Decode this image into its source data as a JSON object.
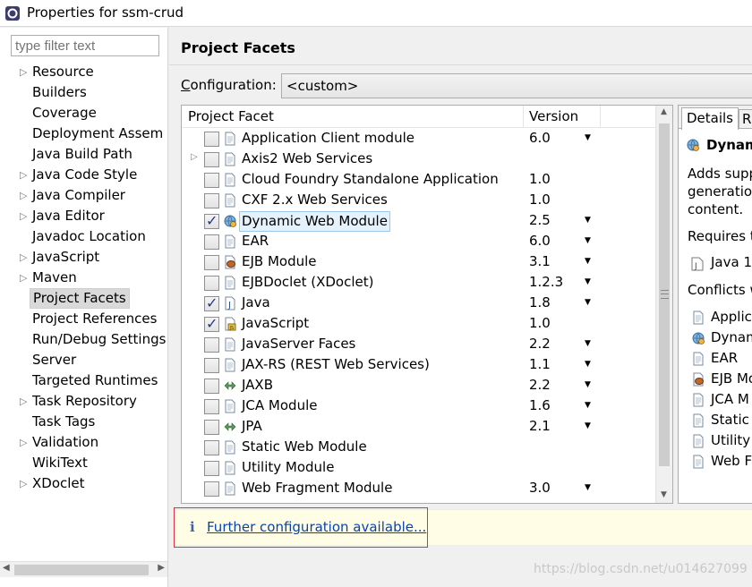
{
  "window": {
    "title": "Properties for ssm-crud"
  },
  "filter": {
    "placeholder": "type filter text"
  },
  "sidebar": {
    "items": [
      {
        "label": "Resource",
        "expandable": true
      },
      {
        "label": "Builders",
        "expandable": false
      },
      {
        "label": "Coverage",
        "expandable": false
      },
      {
        "label": "Deployment Assem",
        "expandable": false
      },
      {
        "label": "Java Build Path",
        "expandable": false
      },
      {
        "label": "Java Code Style",
        "expandable": true
      },
      {
        "label": "Java Compiler",
        "expandable": true
      },
      {
        "label": "Java Editor",
        "expandable": true
      },
      {
        "label": "Javadoc Location",
        "expandable": false
      },
      {
        "label": "JavaScript",
        "expandable": true
      },
      {
        "label": "Maven",
        "expandable": true
      },
      {
        "label": "Project Facets",
        "expandable": false,
        "selected": true
      },
      {
        "label": "Project References",
        "expandable": false
      },
      {
        "label": "Run/Debug Settings",
        "expandable": false
      },
      {
        "label": "Server",
        "expandable": false
      },
      {
        "label": "Targeted Runtimes",
        "expandable": false
      },
      {
        "label": "Task Repository",
        "expandable": true
      },
      {
        "label": "Task Tags",
        "expandable": false
      },
      {
        "label": "Validation",
        "expandable": true
      },
      {
        "label": "WikiText",
        "expandable": false
      },
      {
        "label": "XDoclet",
        "expandable": true
      }
    ]
  },
  "page": {
    "title": "Project Facets",
    "config_label_underlined": "C",
    "config_label_rest": "onfiguration:",
    "config_value": "<custom>"
  },
  "facets": {
    "col_facet": "Project Facet",
    "col_version": "Version",
    "rows": [
      {
        "name": "Application Client module",
        "version": "6.0",
        "checked": false,
        "dropdown": true,
        "icon": "doc-icon"
      },
      {
        "name": "Axis2 Web Services",
        "version": "",
        "checked": false,
        "dropdown": false,
        "icon": "doc-icon",
        "expandable": true
      },
      {
        "name": "Cloud Foundry Standalone Application",
        "version": "1.0",
        "checked": false,
        "dropdown": false,
        "icon": "doc-icon"
      },
      {
        "name": "CXF 2.x Web Services",
        "version": "1.0",
        "checked": false,
        "dropdown": false,
        "icon": "doc-icon"
      },
      {
        "name": "Dynamic Web Module",
        "version": "2.5",
        "checked": true,
        "dropdown": true,
        "icon": "globe-gear-icon",
        "highlight": true
      },
      {
        "name": "EAR",
        "version": "6.0",
        "checked": false,
        "dropdown": true,
        "icon": "doc-icon"
      },
      {
        "name": "EJB Module",
        "version": "3.1",
        "checked": false,
        "dropdown": true,
        "icon": "bean-icon"
      },
      {
        "name": "EJBDoclet (XDoclet)",
        "version": "1.2.3",
        "checked": false,
        "dropdown": true,
        "icon": "doc-icon"
      },
      {
        "name": "Java",
        "version": "1.8",
        "checked": true,
        "dropdown": true,
        "icon": "java-icon"
      },
      {
        "name": "JavaScript",
        "version": "1.0",
        "checked": true,
        "dropdown": false,
        "icon": "js-icon"
      },
      {
        "name": "JavaServer Faces",
        "version": "2.2",
        "checked": false,
        "dropdown": true,
        "icon": "doc-icon"
      },
      {
        "name": "JAX-RS (REST Web Services)",
        "version": "1.1",
        "checked": false,
        "dropdown": true,
        "icon": "doc-icon"
      },
      {
        "name": "JAXB",
        "version": "2.2",
        "checked": false,
        "dropdown": true,
        "icon": "arrows-icon"
      },
      {
        "name": "JCA Module",
        "version": "1.6",
        "checked": false,
        "dropdown": true,
        "icon": "doc-icon"
      },
      {
        "name": "JPA",
        "version": "2.1",
        "checked": false,
        "dropdown": true,
        "icon": "arrows-icon"
      },
      {
        "name": "Static Web Module",
        "version": "",
        "checked": false,
        "dropdown": false,
        "icon": "doc-icon"
      },
      {
        "name": "Utility Module",
        "version": "",
        "checked": false,
        "dropdown": false,
        "icon": "doc-icon"
      },
      {
        "name": "Web Fragment Module",
        "version": "3.0",
        "checked": false,
        "dropdown": true,
        "icon": "doc-icon"
      }
    ]
  },
  "details": {
    "tab_details": "Details",
    "tab_runtimes": "Ru",
    "title": "Dynam",
    "desc_lines": [
      "Adds supp",
      "generation",
      "content."
    ],
    "requires_label": "Requires t",
    "requires_item": "Java 1.",
    "conflicts_label": "Conflicts w",
    "conflicts": [
      {
        "label": "Applic",
        "icon": "doc-icon"
      },
      {
        "label": "Dynam",
        "icon": "globe-gear-icon"
      },
      {
        "label": "EAR",
        "icon": "doc-icon"
      },
      {
        "label": "EJB Mo",
        "icon": "bean-icon"
      },
      {
        "label": "JCA M",
        "icon": "doc-icon"
      },
      {
        "label": "Static W",
        "icon": "doc-icon"
      },
      {
        "label": "Utility",
        "icon": "doc-icon"
      },
      {
        "label": "Web F",
        "icon": "doc-icon"
      }
    ]
  },
  "infobar": {
    "icon": "i",
    "link": "Further configuration available..."
  },
  "watermark": "https://blog.csdn.net/u014627099",
  "colors": {
    "link": "#0645ad",
    "info_bg": "#fffde6",
    "highlight_border": "#e0323c",
    "selection": "#e5f1fb"
  }
}
